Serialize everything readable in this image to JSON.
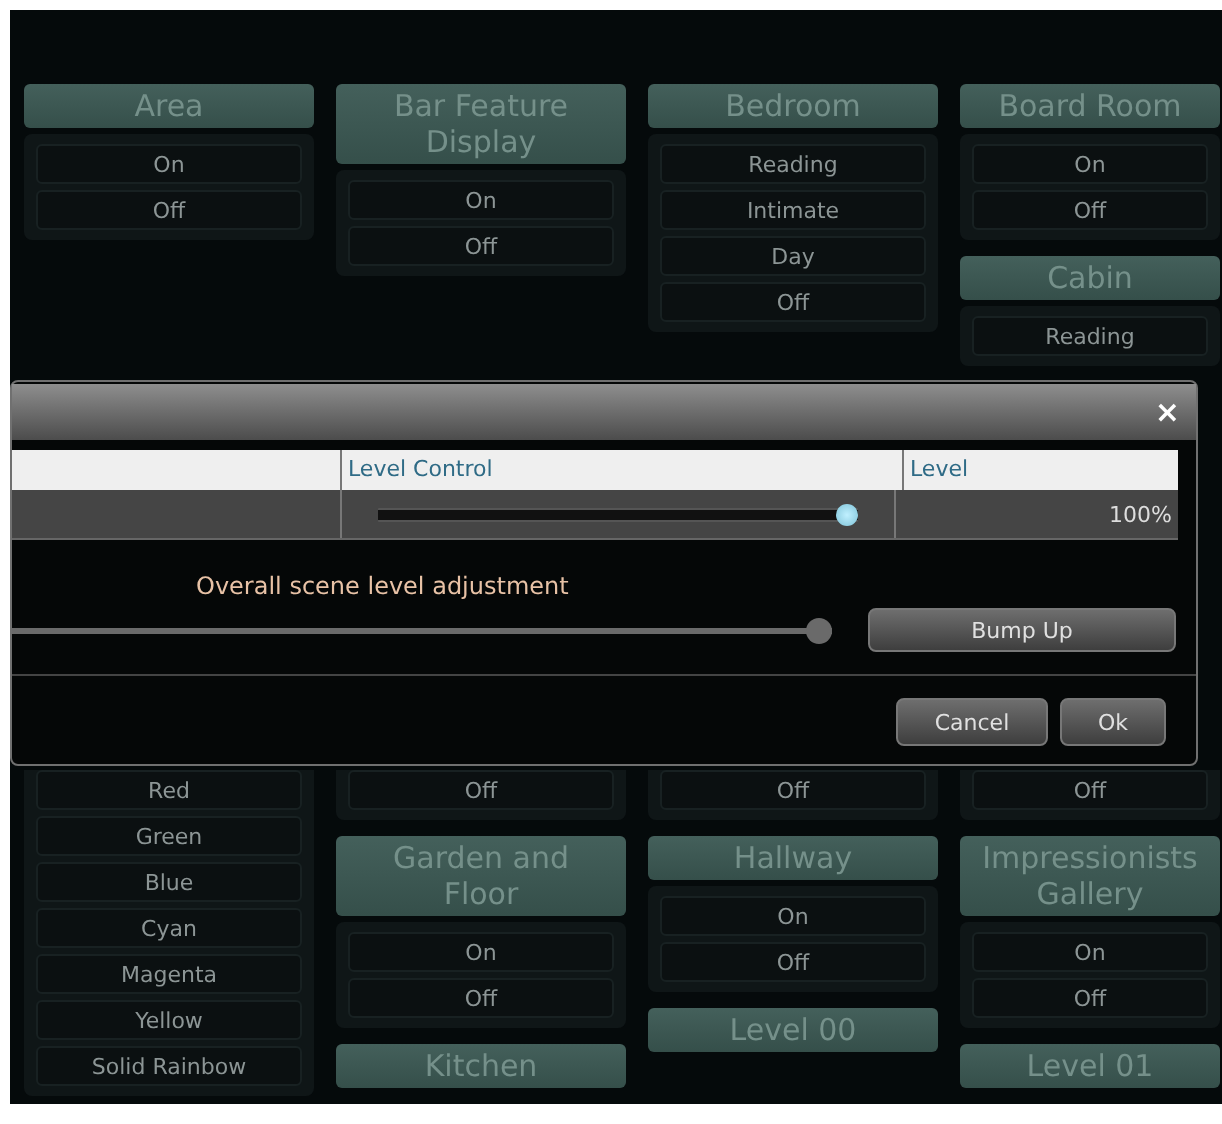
{
  "columns": [
    {
      "top": [
        {
          "title": "Area",
          "items": [
            "On",
            "Off"
          ]
        }
      ],
      "bottom": [
        {
          "items": [
            "Red",
            "Green",
            "Blue",
            "Cyan",
            "Magenta",
            "Yellow",
            "Solid Rainbow"
          ]
        }
      ]
    },
    {
      "top": [
        {
          "title": "Bar Feature Display",
          "items": [
            "On",
            "Off"
          ]
        }
      ],
      "bottom": [
        {
          "items": [
            "Off"
          ]
        },
        {
          "title": "Garden and Floor",
          "items": [
            "On",
            "Off"
          ]
        },
        {
          "title": "Kitchen"
        }
      ]
    },
    {
      "top": [
        {
          "title": "Bedroom",
          "items": [
            "Reading",
            "Intimate",
            "Day",
            "Off"
          ]
        }
      ],
      "bottom": [
        {
          "items": [
            "Off"
          ]
        },
        {
          "title": "Hallway",
          "items": [
            "On",
            "Off"
          ]
        },
        {
          "title": "Level 00"
        }
      ]
    },
    {
      "top": [
        {
          "title": "Board Room",
          "items": [
            "On",
            "Off"
          ]
        },
        {
          "title": "Cabin",
          "items": [
            "Reading"
          ]
        }
      ],
      "bottom": [
        {
          "items": [
            "Off"
          ]
        },
        {
          "title": "Impressionists Gallery",
          "items": [
            "On",
            "Off"
          ]
        },
        {
          "title": "Level 01"
        }
      ]
    }
  ],
  "dialog": {
    "close": "×",
    "table": {
      "columns": [
        "Level Control",
        "Level"
      ],
      "rows": [
        {
          "level": 1,
          "reading": "100%"
        }
      ]
    },
    "adjustment": {
      "label": "Overall scene level adjustment",
      "level": 1,
      "button": "Bump Up"
    },
    "buttons": [
      "Cancel",
      "Ok"
    ]
  }
}
